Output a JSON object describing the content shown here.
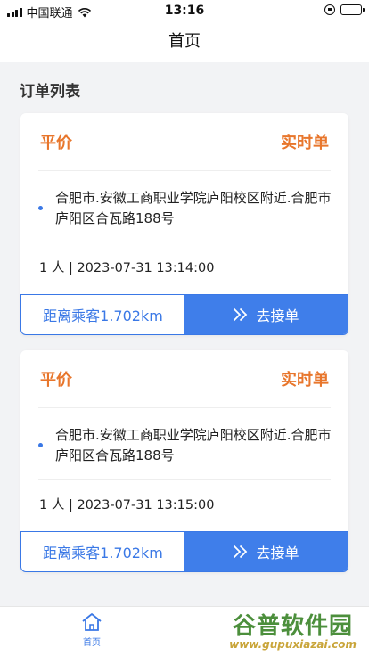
{
  "status_bar": {
    "carrier": "中国联通",
    "time": "13:16"
  },
  "header": {
    "title": "首页"
  },
  "orders": {
    "section_title": "订单列表",
    "items": [
      {
        "price_type": "平价",
        "order_type": "实时单",
        "address": "合肥市.安徽工商职业学院庐阳校区附近.合肥市庐阳区合瓦路188号",
        "info": "1 人 | 2023-07-31 13:14:00",
        "distance_label": "距离乘客1.702km",
        "accept_label": "去接单"
      },
      {
        "price_type": "平价",
        "order_type": "实时单",
        "address": "合肥市.安徽工商职业学院庐阳校区附近.合肥市庐阳区合瓦路188号",
        "info": "1 人 | 2023-07-31 13:15:00",
        "distance_label": "距离乘客1.702km",
        "accept_label": "去接单"
      }
    ]
  },
  "tab_bar": {
    "items": [
      {
        "label": "首页",
        "icon": "home-icon",
        "active": true
      }
    ]
  },
  "watermark": {
    "text": "谷普软件园",
    "url": "www.gupuxiazai.com"
  },
  "colors": {
    "accent_blue": "#3f7eea",
    "accent_orange": "#e8762c",
    "background": "#f2f3f5"
  }
}
